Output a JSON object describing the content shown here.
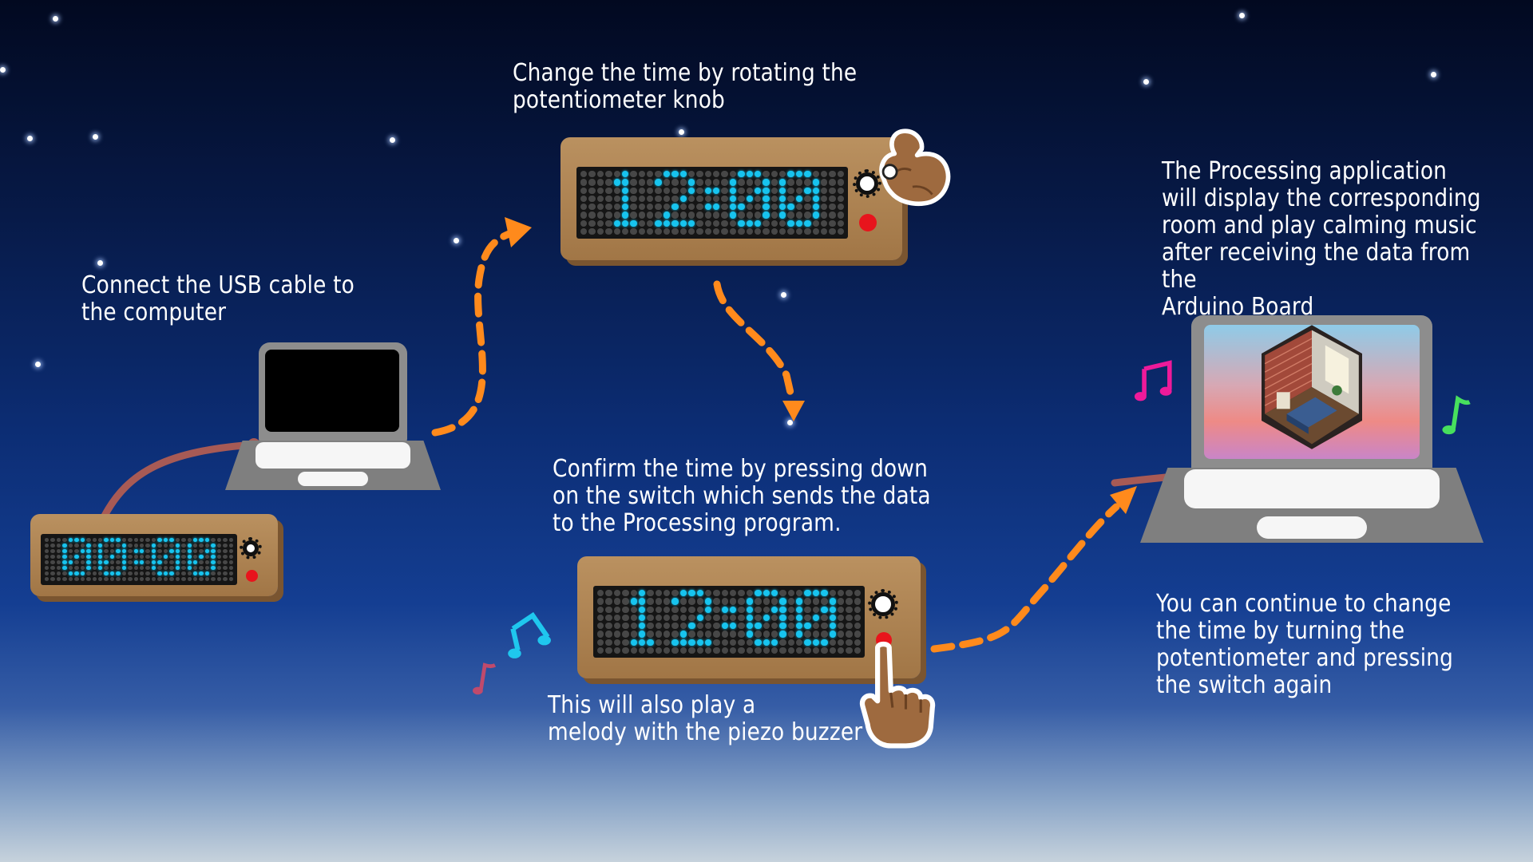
{
  "steps": {
    "connect": "Connect the USB cable to\nthe computer",
    "rotate": "Change the time by rotating the\npotentiometer knob",
    "confirm": "Confirm the time by pressing down\non the switch which sends the data\nto the Processing program.",
    "melody": "This will also play a\nmelody with the piezo buzzer",
    "processing": "The Processing application\nwill display the corresponding\nroom and play calming music\nafter receiving the data from the\nArduino Board",
    "continue": "You can continue to change\nthe time by turning the\npotentiometer and pressing\nthe switch again"
  },
  "displays": {
    "device1": "00:00",
    "device2": "12:00",
    "device3": "12:00"
  },
  "colors": {
    "led_on": "#17c4ef",
    "led_off": "#474747",
    "arrow": "#ff8a1c",
    "cable": "#a75a55",
    "wood": "#ba9160",
    "switch_red": "#e8141c"
  },
  "icons": {
    "device_knob": "potentiometer-knob-icon",
    "device_switch": "push-switch-icon",
    "hand_rotate": "pinching-hand-icon",
    "hand_press": "pointing-hand-icon",
    "notes": "music-note-icon",
    "room": "isometric-bedroom-icon"
  }
}
